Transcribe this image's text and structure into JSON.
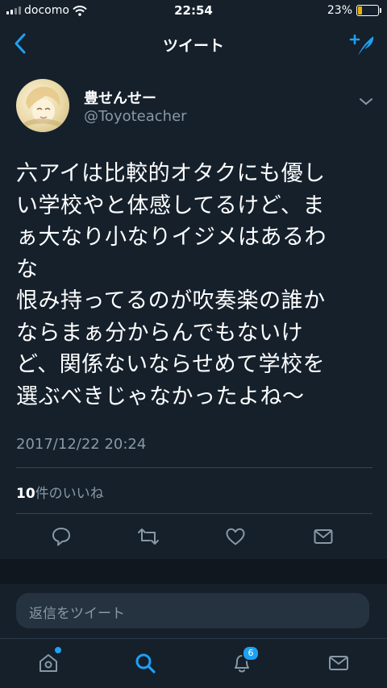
{
  "status_bar": {
    "carrier": "docomo",
    "time": "22:54",
    "battery_percent": "23%",
    "battery_level": 0.23,
    "battery_color": "#e8b300",
    "icons": [
      "signal-icon",
      "wifi-icon",
      "battery-icon"
    ]
  },
  "nav": {
    "title": "ツイート",
    "back_icon": "chevron-left-icon",
    "compose_icon": "compose-tweet-icon",
    "accent": "#1da1f2"
  },
  "tweet": {
    "user": {
      "name": "豊せんせー",
      "handle": "@Toyoteacher"
    },
    "text_lines": [
      "六アイは比較的オタクにも優し",
      "い学校やと体感してるけど、ま",
      "ぁ大なり小なりイジメはあるわ",
      "な",
      "恨み持ってるのが吹奏楽の誰か",
      "ならまぁ分からんでもないけ",
      "ど、関係ないならせめて学校を",
      "選ぶべきじゃなかったよね〜"
    ],
    "timestamp": "2017/12/22 20:24",
    "likes": {
      "count": "10",
      "label": "件のいいね"
    },
    "actions": [
      "reply-icon",
      "retweet-icon",
      "like-icon",
      "dm-icon"
    ]
  },
  "reply": {
    "placeholder": "返信をツイート"
  },
  "tabbar": {
    "tabs": [
      "home-icon",
      "search-icon",
      "notifications-icon",
      "messages-icon"
    ],
    "active": "search-icon",
    "notifications_badge": "6"
  }
}
